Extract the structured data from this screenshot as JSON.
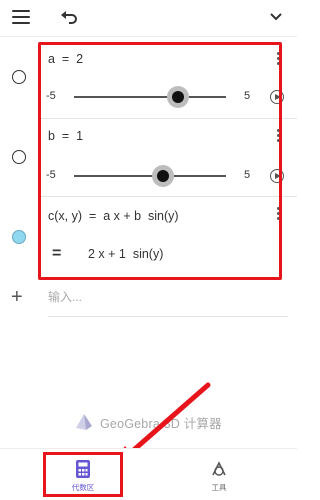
{
  "toolbar": {
    "menu_icon": "menu-icon",
    "undo_icon": "undo-icon",
    "collapse_icon": "chevron-down-icon"
  },
  "algebra": {
    "slider_a": {
      "expression": "a  =  2",
      "min_label": "-5",
      "max_label": "5",
      "value": 2,
      "min": -5,
      "max": 5
    },
    "slider_b": {
      "expression": "b  =  1",
      "min_label": "-5",
      "max_label": "5",
      "value": 1,
      "min": -5,
      "max": 5
    },
    "function_c": {
      "definition": "c(x, y)  =  a x + b  sin(y)",
      "equals_sign": "=",
      "value": "2 x + 1  sin(y)"
    }
  },
  "input": {
    "placeholder": "输入..."
  },
  "brand": {
    "name": "GeoGebra 3D 计算器"
  },
  "tabs": [
    {
      "label": "代数区",
      "icon": "calculator-icon",
      "active": true
    },
    {
      "label": "工具",
      "icon": "tools-icon",
      "active": false
    }
  ],
  "colors": {
    "highlight": "#e8141b",
    "active_tab": "#6557d2",
    "visible_dot": "#8fd8ef"
  }
}
